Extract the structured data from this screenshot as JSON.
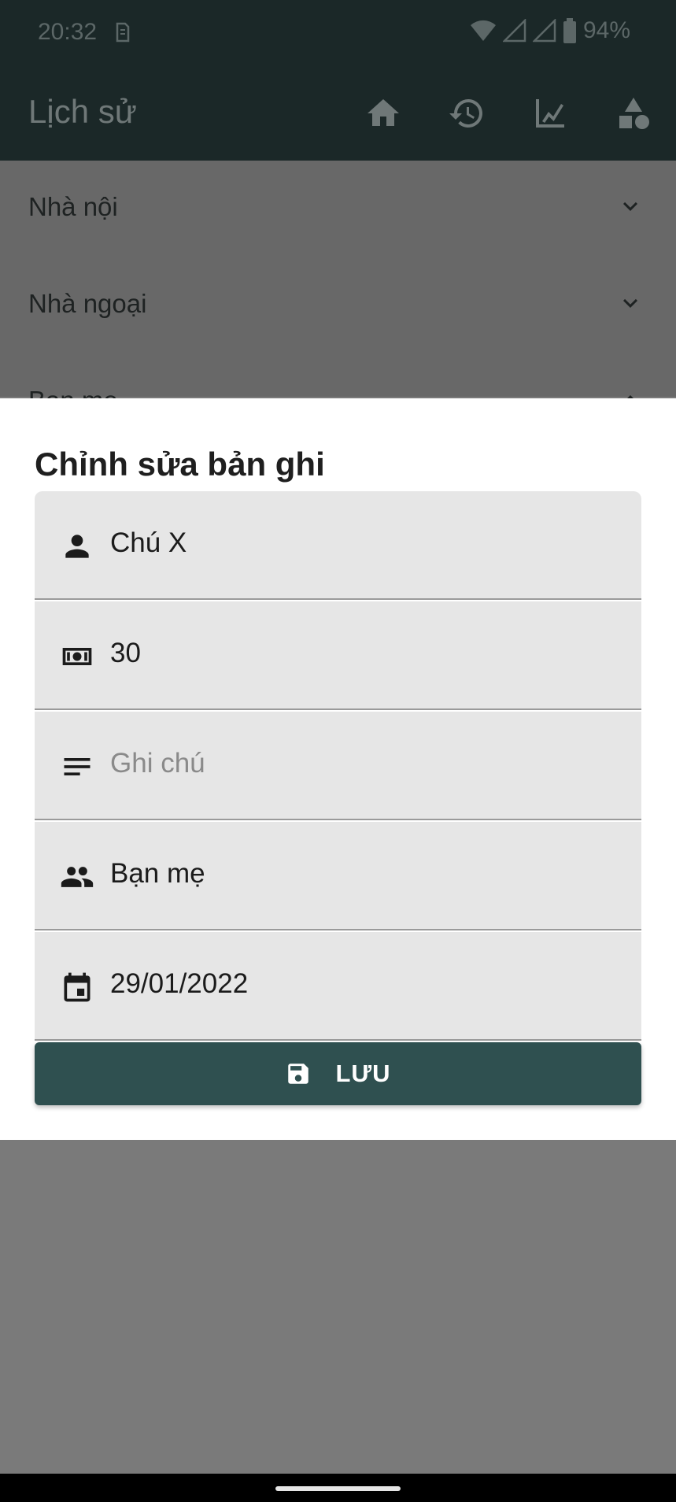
{
  "status_bar": {
    "time": "20:32",
    "battery": "94%"
  },
  "app_bar": {
    "title": "Lịch sử",
    "icons": [
      "home-icon",
      "history-icon",
      "chart-icon",
      "category-icon"
    ]
  },
  "background_list": {
    "items": [
      {
        "label": "Nhà nội"
      },
      {
        "label": "Nhà ngoại"
      },
      {
        "label": "Bạn mẹ"
      }
    ]
  },
  "sheet": {
    "title": "Chỉnh sửa bản ghi",
    "fields": {
      "name": {
        "value": "Chú X",
        "icon": "person-icon"
      },
      "amount": {
        "value": "30",
        "icon": "money-icon"
      },
      "note": {
        "placeholder": "Ghi chú",
        "icon": "notes-icon"
      },
      "group": {
        "value": "Bạn mẹ",
        "icon": "people-icon"
      },
      "date": {
        "value": "29/01/2022",
        "icon": "calendar-icon"
      }
    },
    "save_label": "LƯU"
  },
  "colors": {
    "app_bar_bg": "#1b2828",
    "button_bg": "#2f5050",
    "field_bg": "#e6e6e6",
    "scrim": "#7a7a7a"
  }
}
